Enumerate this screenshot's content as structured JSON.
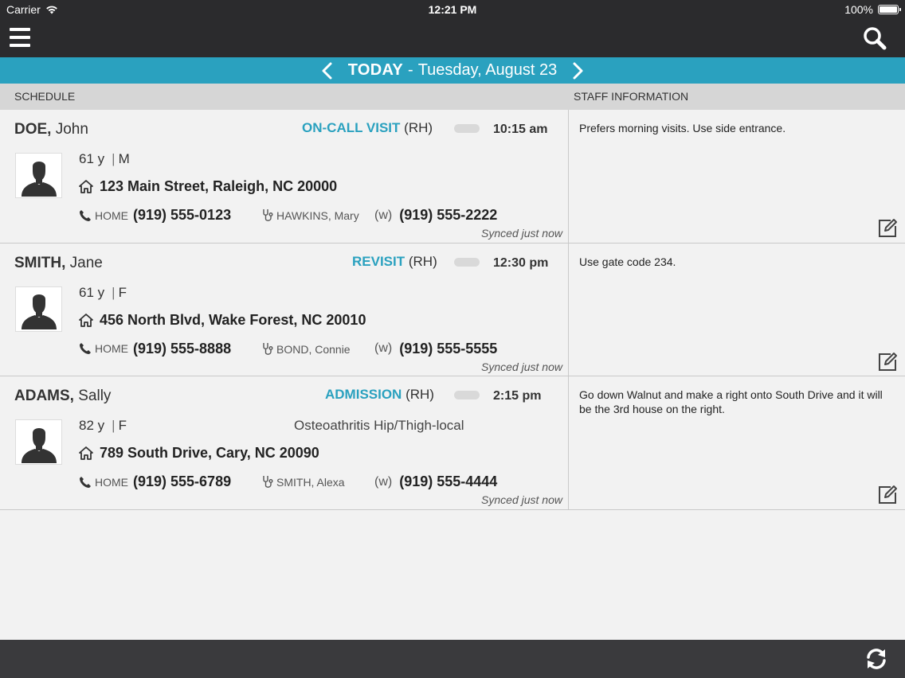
{
  "status_bar": {
    "carrier": "Carrier",
    "time": "12:21 PM",
    "battery": "100%"
  },
  "nav": {
    "menu_icon": "hamburger-icon",
    "search_icon": "search-icon"
  },
  "date_bar": {
    "today": "TODAY",
    "separator": "-",
    "date": "Tuesday, August 23"
  },
  "columns": {
    "schedule": "SCHEDULE",
    "staff_info": "STAFF INFORMATION"
  },
  "visits": [
    {
      "last": "DOE,",
      "first": "John",
      "visit_type": "ON-CALL VISIT",
      "visit_code": "(RH)",
      "time": "10:15 am",
      "age": "61 y",
      "gender": "M",
      "diagnosis": "",
      "address": "123 Main Street, Raleigh, NC 20000",
      "phone_label": "HOME",
      "phone": "(919) 555-0123",
      "caregiver": "HAWKINS, Mary",
      "work_label": "(w)",
      "work_phone": "(919) 555-2222",
      "synced": "Synced just now",
      "staff_note": "Prefers morning visits. Use side entrance."
    },
    {
      "last": "SMITH,",
      "first": "Jane",
      "visit_type": "REVISIT",
      "visit_code": "(RH)",
      "time": "12:30 pm",
      "age": "61 y",
      "gender": "F",
      "diagnosis": "",
      "address": "456 North Blvd, Wake Forest, NC 20010",
      "phone_label": "HOME",
      "phone": "(919) 555-8888",
      "caregiver": "BOND, Connie",
      "work_label": "(w)",
      "work_phone": "(919) 555-5555",
      "synced": "Synced just now",
      "staff_note": "Use gate code 234."
    },
    {
      "last": "ADAMS,",
      "first": "Sally",
      "visit_type": "ADMISSION",
      "visit_code": "(RH)",
      "time": "2:15 pm",
      "age": "82 y",
      "gender": "F",
      "diagnosis": "Osteoathritis Hip/Thigh-local",
      "address": "789 South Drive, Cary, NC 20090",
      "phone_label": "HOME",
      "phone": "(919) 555-6789",
      "caregiver": "SMITH, Alexa",
      "work_label": "(w)",
      "work_phone": "(919) 555-4444",
      "synced": "Synced just now",
      "staff_note": "Go down Walnut and make a right onto South Drive and it will be the 3rd house on the right."
    }
  ],
  "colors": {
    "accent": "#2aa1bf",
    "bar_dark": "#2b2b2d"
  }
}
